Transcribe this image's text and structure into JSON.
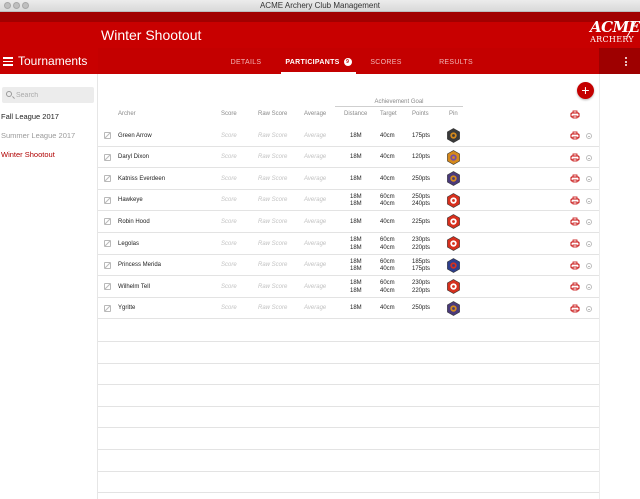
{
  "window": {
    "title": "ACME Archery Club Management"
  },
  "header": {
    "page_title": "Winter Shootout",
    "logo": {
      "line1": "ACME",
      "line2": "ARCHERY"
    }
  },
  "sidebar": {
    "title": "Tournaments",
    "search_placeholder": "Search",
    "items": [
      {
        "label": "Fall League 2017",
        "state": "normal"
      },
      {
        "label": "Summer League 2017",
        "state": "muted"
      },
      {
        "label": "Winter Shootout",
        "state": "active"
      }
    ]
  },
  "tabs": [
    {
      "label": "DETAILS",
      "active": false
    },
    {
      "label": "PARTICIPANTS",
      "active": true,
      "badge": "9"
    },
    {
      "label": "SCORES",
      "active": false
    },
    {
      "label": "RESULTS",
      "active": false
    }
  ],
  "table": {
    "columns": {
      "archer": "Archer",
      "score": "Score",
      "raw_score": "Raw Score",
      "average": "Average",
      "achievement_goal": "Achievement Goal",
      "distance": "Distance",
      "target": "Target",
      "points": "Points",
      "pin": "Pin"
    },
    "placeholders": {
      "score": "Score",
      "raw_score": "Raw Score",
      "average": "Average"
    },
    "rows": [
      {
        "archer": "Green Arrow",
        "distance": [
          "18M"
        ],
        "target": [
          "40cm"
        ],
        "points": [
          "175pts"
        ],
        "pin_color": "#3a3a3a",
        "pin_inner": "#d4891c"
      },
      {
        "archer": "Daryl Dixon",
        "distance": [
          "18M"
        ],
        "target": [
          "40cm"
        ],
        "points": [
          "120pts"
        ],
        "pin_color": "#d4891c",
        "pin_inner": "#7a4ea0"
      },
      {
        "archer": "Katniss Everdeen",
        "distance": [
          "18M"
        ],
        "target": [
          "40cm"
        ],
        "points": [
          "250pts"
        ],
        "pin_color": "#4a3a7a",
        "pin_inner": "#d4891c"
      },
      {
        "archer": "Hawkeye",
        "distance": [
          "18M",
          "18M"
        ],
        "target": [
          "60cm",
          "40cm"
        ],
        "points": [
          "250pts",
          "240pts"
        ],
        "pin_color": "#d6301e",
        "pin_inner": "#ffffff"
      },
      {
        "archer": "Robin Hood",
        "distance": [
          "18M"
        ],
        "target": [
          "40cm"
        ],
        "points": [
          "225pts"
        ],
        "pin_color": "#d6301e",
        "pin_inner": "#ffffff"
      },
      {
        "archer": "Legolas",
        "distance": [
          "18M",
          "18M"
        ],
        "target": [
          "60cm",
          "40cm"
        ],
        "points": [
          "230pts",
          "220pts"
        ],
        "pin_color": "#d6301e",
        "pin_inner": "#ffffff"
      },
      {
        "archer": "Princess Merida",
        "distance": [
          "18M",
          "18M"
        ],
        "target": [
          "60cm",
          "40cm"
        ],
        "points": [
          "185pts",
          "175pts"
        ],
        "pin_color": "#2e3f8c",
        "pin_inner": "#d6301e"
      },
      {
        "archer": "Wilhelm Tell",
        "distance": [
          "18M",
          "18M"
        ],
        "target": [
          "60cm",
          "40cm"
        ],
        "points": [
          "230pts",
          "220pts"
        ],
        "pin_color": "#d6301e",
        "pin_inner": "#ffffff"
      },
      {
        "archer": "Ygritte",
        "distance": [
          "18M"
        ],
        "target": [
          "40cm"
        ],
        "points": [
          "250pts"
        ],
        "pin_color": "#4a3a7a",
        "pin_inner": "#d4891c"
      }
    ]
  },
  "colors": {
    "brand": "#c80000",
    "brand_dark": "#a10000",
    "active_link": "#b00000",
    "muted": "#9a9a9a"
  },
  "icons": {
    "menu": "hamburger-icon",
    "kebab": "kebab-menu-icon",
    "search": "search-icon",
    "add": "plus-icon",
    "edit": "edit-icon",
    "print": "print-icon",
    "remove": "remove-icon"
  }
}
